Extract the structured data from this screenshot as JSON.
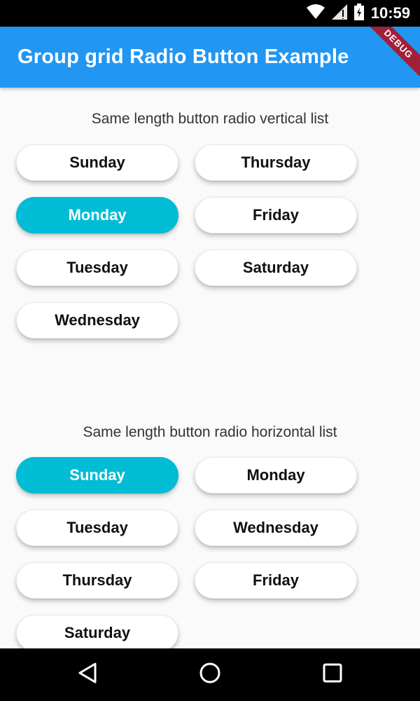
{
  "status_bar": {
    "time": "10:59"
  },
  "app_bar": {
    "title": "Group grid Radio Button Example",
    "debug_label": "DEBUG"
  },
  "vertical_group": {
    "title": "Same length button radio vertical list",
    "selected": "Monday",
    "col1": [
      "Sunday",
      "Monday",
      "Tuesday",
      "Wednesday"
    ],
    "col2": [
      "Thursday",
      "Friday",
      "Saturday"
    ]
  },
  "horizontal_group": {
    "title": "Same length button radio horizontal list",
    "selected": "Sunday",
    "col1": [
      "Sunday",
      "Tuesday",
      "Thursday",
      "Saturday"
    ],
    "col2": [
      "Monday",
      "Wednesday",
      "Friday"
    ]
  },
  "colors": {
    "app_bar": "#2196f3",
    "selected": "#00bcd4",
    "debug_banner": "#a0203a"
  },
  "nav_icons": [
    "back-icon",
    "home-icon",
    "recents-icon"
  ]
}
